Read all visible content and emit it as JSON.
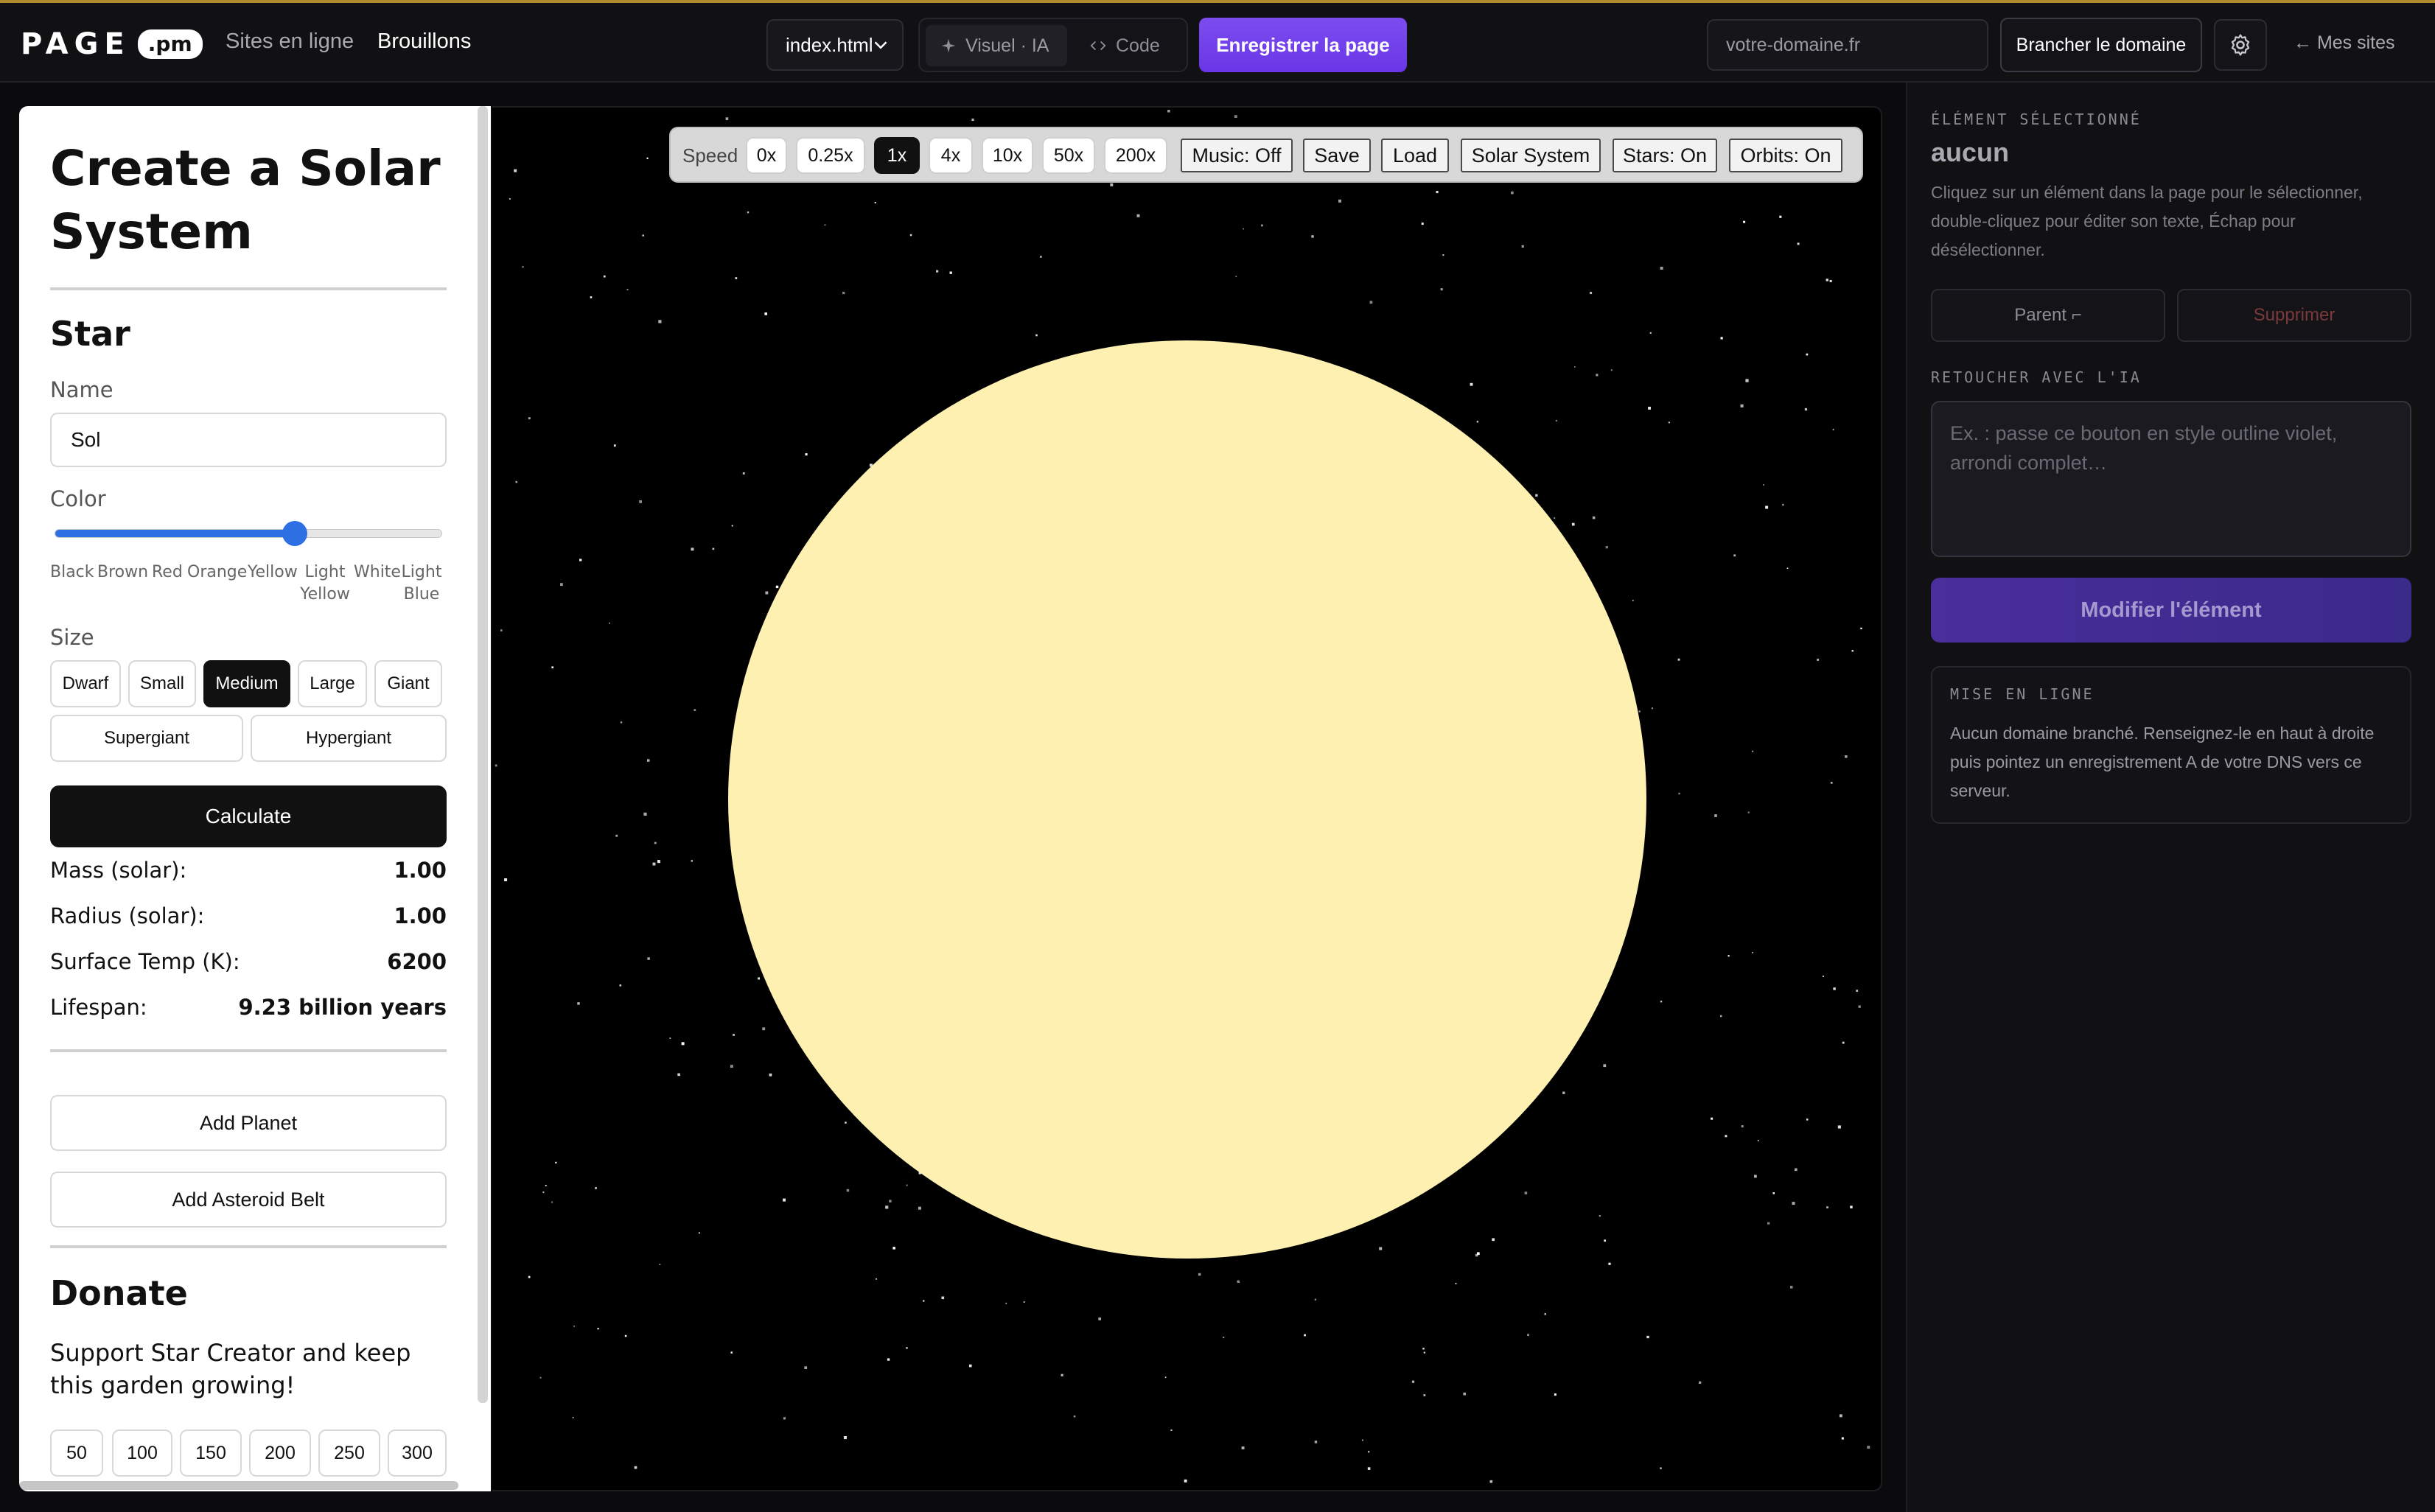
{
  "topbar": {
    "logo_text": "PAGE",
    "logo_badge": ".pm",
    "nav": [
      "Sites en ligne",
      "Brouillons"
    ],
    "file_select": "index.html",
    "modes": [
      "Visuel · IA",
      "Code"
    ],
    "save_label": "Enregistrer la page",
    "domain_placeholder": "votre-domaine.fr",
    "connect_label": "Brancher le domaine",
    "my_sites_label": "← Mes sites"
  },
  "left_panel": {
    "title": "Create a Solar System",
    "star_heading": "Star",
    "name_label": "Name",
    "name_value": "Sol",
    "color_label": "Color",
    "color_slider_value": 0.62,
    "color_ticks": [
      "Black",
      "Brown",
      "Red",
      "Orange",
      "Yellow",
      "Light Yellow",
      "White",
      "Light Blue"
    ],
    "size_label": "Size",
    "sizes": [
      "Dwarf",
      "Small",
      "Medium",
      "Large",
      "Giant",
      "Supergiant",
      "Hypergiant"
    ],
    "selected_size": "Medium",
    "calculate_label": "Calculate",
    "stats": [
      {
        "label": "Mass (solar):",
        "value": "1.00"
      },
      {
        "label": "Radius (solar):",
        "value": "1.00"
      },
      {
        "label": "Surface Temp (K):",
        "value": "6200"
      },
      {
        "label": "Lifespan:",
        "value": "9.23 billion years"
      }
    ],
    "add_planet_label": "Add Planet",
    "add_belt_label": "Add Asteroid Belt",
    "donate_heading": "Donate",
    "donate_text": "Support Star Creator and keep this garden growing!",
    "amounts": [
      "50",
      "100",
      "150",
      "200",
      "250",
      "300"
    ]
  },
  "sim_toolbar": {
    "speed_label": "Speed",
    "speeds": [
      "0x",
      "0.25x",
      "1x",
      "4x",
      "10x",
      "50x",
      "200x"
    ],
    "selected_speed": "1x",
    "music_label": "Music: Off",
    "save_label": "Save",
    "load_label": "Load",
    "solar_system_label": "Solar System",
    "stars_label": "Stars: On",
    "orbits_label": "Orbits: On"
  },
  "canvas": {
    "sun_color": "#fdf0b0",
    "background": "#000000"
  },
  "right_panel": {
    "selected_caption": "ÉLÉMENT SÉLECTIONNÉ",
    "selected_value": "aucun",
    "help_text": "Cliquez sur un élément dans la page pour le sélectionner, double-cliquez pour éditer son texte, Échap pour désélectionner.",
    "parent_label": "Parent ⌐",
    "delete_label": "Supprimer",
    "ai_caption": "RETOUCHER AVEC L'IA",
    "ai_placeholder": "Ex. : passe ce bouton en style outline violet, arrondi complet…",
    "modify_label": "Modifier l'élément",
    "publish_caption": "MISE EN LIGNE",
    "publish_text": "Aucun domaine branché. Renseignez-le en haut à droite puis pointez un enregistrement A de votre DNS vers ce serveur."
  },
  "colors": {
    "accent": "#6a36e6",
    "slider": "#2f6fe4"
  }
}
